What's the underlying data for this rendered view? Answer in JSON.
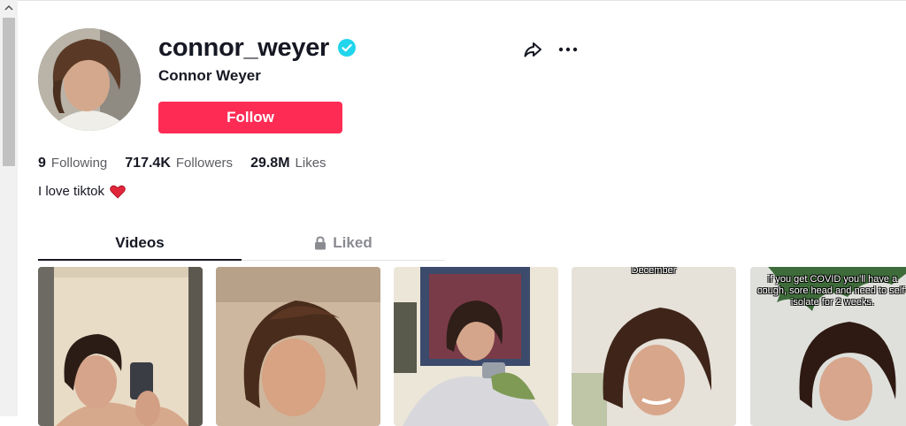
{
  "profile": {
    "username": "connor_weyer",
    "nickname": "Connor Weyer",
    "verified": true,
    "follow_label": "Follow",
    "bio": "I love tiktok",
    "bio_emoji": "heart-icon"
  },
  "stats": [
    {
      "value": "9",
      "label": "Following"
    },
    {
      "value": "717.4K",
      "label": "Followers"
    },
    {
      "value": "29.8M",
      "label": "Likes"
    }
  ],
  "tabs": {
    "videos": "Videos",
    "liked": "Liked",
    "active": "Videos"
  },
  "videos": [
    {
      "caption": ""
    },
    {
      "caption": ""
    },
    {
      "caption": ""
    },
    {
      "caption": "December"
    },
    {
      "caption": "if you get COVID you'll have a cough, sore head and need to self-isolate for 2 weeks."
    }
  ],
  "colors": {
    "follow_button": "#fe2c55",
    "verified_badge": "#20d5ec",
    "text_primary": "#161823",
    "text_secondary": "#8a8b91"
  }
}
